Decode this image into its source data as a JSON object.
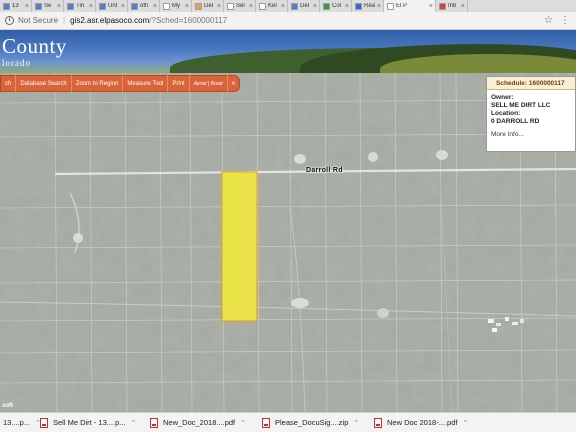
{
  "browser": {
    "tabs": [
      {
        "label": "13",
        "color": "#4e7fd1"
      },
      {
        "label": "Se",
        "color": "#4e7fd1"
      },
      {
        "label": "Tin",
        "color": "#4e7fd1"
      },
      {
        "label": "Unt",
        "color": "#4e7fd1"
      },
      {
        "label": "offi",
        "color": "#4e7fd1"
      },
      {
        "label": "My",
        "color": "#ffffff"
      },
      {
        "label": "Det",
        "color": "#e8a24a"
      },
      {
        "label": "Sel",
        "color": "#ffffff"
      },
      {
        "label": "Ker",
        "color": "#ffffff"
      },
      {
        "label": "Det",
        "color": "#4e7fd1"
      },
      {
        "label": "Col",
        "color": "#3a9a4a"
      },
      {
        "label": "Rea",
        "color": "#2f6fd1"
      },
      {
        "label": "El P",
        "color": "#ffffff"
      },
      {
        "label": "Inb",
        "color": "#d44638"
      }
    ],
    "active_tab_index": 12,
    "security_label": "Not Secure",
    "url_domain": "gis2.asr.elpasoco.com",
    "url_path": "/?Sched=1600000117"
  },
  "banner": {
    "county": "County",
    "state": "lorado"
  },
  "toolbar": {
    "buttons": [
      {
        "label": "ch",
        "name": "search-button"
      },
      {
        "label": "Database Search",
        "name": "database-search-button"
      },
      {
        "label": "Zoom to Region",
        "name": "zoom-to-region-button"
      },
      {
        "label": "Measure Tool",
        "name": "measure-tool-button"
      },
      {
        "label": "Print",
        "name": "print-button"
      },
      {
        "label": "Aerial | Road",
        "name": "aerial-road-toggle"
      },
      {
        "label": "«",
        "name": "collapse-toolbar-button"
      }
    ]
  },
  "popup": {
    "schedule": "Schedule: 1600000117",
    "owner_label": "Owner:",
    "owner_value": "SELL ME DIRT LLC",
    "location_label": "Location:",
    "location_value": "0 DARROLL RD",
    "more_info": "More Info..."
  },
  "map": {
    "road_label": "Darroll Rd",
    "attribution": "soft",
    "highlight_color": "#f3ea3a"
  },
  "downloads": [
    {
      "label": "13....p..."
    },
    {
      "label": "Sell Me Dirt - 13....p..."
    },
    {
      "label": "New_Doc_2018....pdf"
    },
    {
      "label": "Please_DocuSig....zip"
    },
    {
      "label": "New Doc 2018-....pdf"
    }
  ]
}
